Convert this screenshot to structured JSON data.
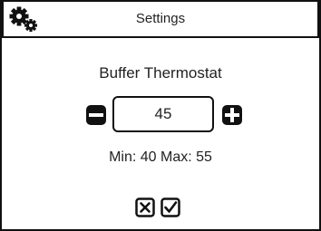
{
  "header": {
    "title": "Settings",
    "icon": "gears-icon"
  },
  "setting": {
    "label": "Buffer Thermostat",
    "value": "45",
    "range_text": "Min: 40 Max: 55"
  },
  "icons": {
    "decrement": "minus-icon",
    "increment": "plus-icon",
    "cancel": "close-box-icon",
    "confirm": "check-box-icon"
  },
  "colors": {
    "foreground": "#111111",
    "background": "#ffffff"
  }
}
